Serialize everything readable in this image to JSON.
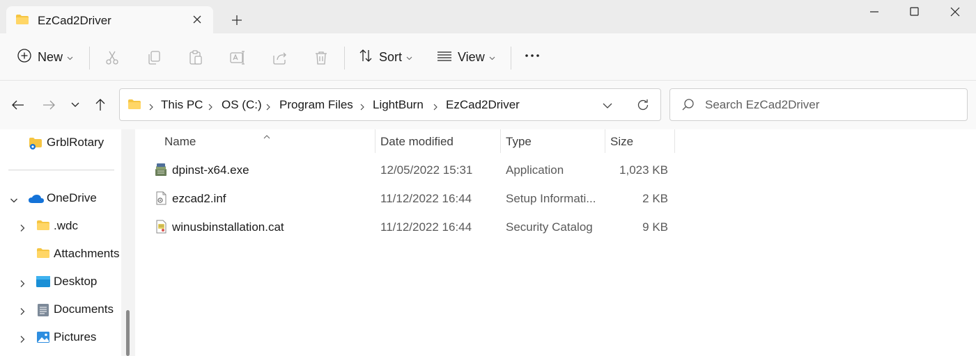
{
  "tab": {
    "title": "EzCad2Driver"
  },
  "toolbar": {
    "new_label": "New",
    "sort_label": "Sort",
    "view_label": "View",
    "more_label": "···"
  },
  "breadcrumb": [
    "This PC",
    "OS (C:)",
    "Program Files",
    "LightBurn",
    "EzCad2Driver"
  ],
  "search": {
    "placeholder": "Search EzCad2Driver"
  },
  "sidebar": {
    "items": [
      {
        "label": "GrblRotary",
        "icon": "folder-link-icon"
      },
      {
        "label": "OneDrive",
        "icon": "onedrive-cloud-icon",
        "expanded": true
      },
      {
        "label": ".wdc",
        "icon": "folder-icon"
      },
      {
        "label": "Attachments",
        "icon": "folder-icon"
      },
      {
        "label": "Desktop",
        "icon": "desktop-icon"
      },
      {
        "label": "Documents",
        "icon": "documents-icon"
      },
      {
        "label": "Pictures",
        "icon": "pictures-icon"
      }
    ]
  },
  "columns": {
    "name": "Name",
    "date": "Date modified",
    "type": "Type",
    "size": "Size"
  },
  "files": [
    {
      "name": "dpinst-x64.exe",
      "date": "12/05/2022 15:31",
      "type": "Application",
      "size": "1,023 KB",
      "icon": "installer-icon"
    },
    {
      "name": "ezcad2.inf",
      "date": "11/12/2022 16:44",
      "type": "Setup Informati...",
      "size": "2 KB",
      "icon": "setup-info-icon"
    },
    {
      "name": "winusbinstallation.cat",
      "date": "11/12/2022 16:44",
      "type": "Security Catalog",
      "size": "9 KB",
      "icon": "security-catalog-icon"
    }
  ],
  "colors": {
    "folder": "#f5c542",
    "onedrive": "#1473d8",
    "accent": "#0067c0"
  }
}
